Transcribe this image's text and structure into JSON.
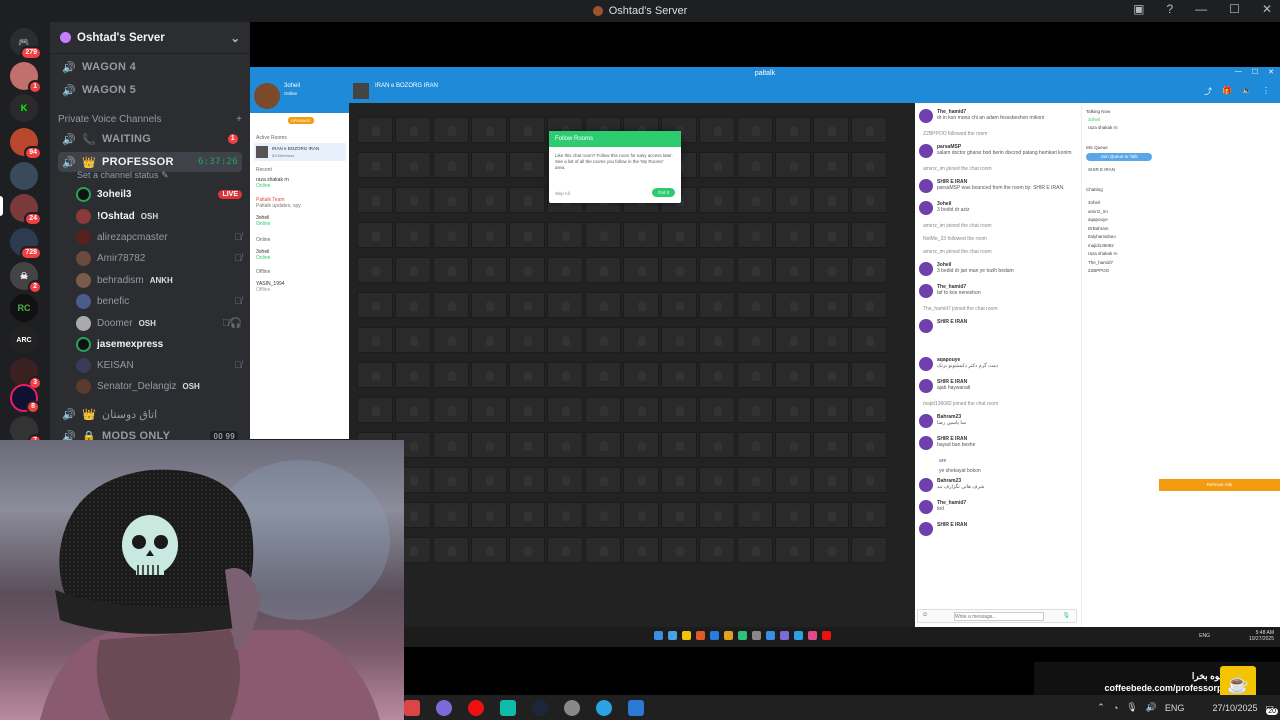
{
  "window": {
    "title": "Oshtad's Server"
  },
  "servers": {
    "badges": [
      "279",
      "1",
      "94",
      "24",
      "728",
      "2",
      "3",
      "8",
      "7"
    ]
  },
  "sidebar": {
    "server_name": "Oshtad's Server",
    "channels": [
      {
        "name": "WAGON 4"
      },
      {
        "name": "WAGON 5"
      }
    ],
    "category": "Private Voice Channels",
    "waiting": {
      "name": "WAITING",
      "count": "1"
    },
    "professor": {
      "name": "PROFESSOR",
      "timer": "6:37:26",
      "status": "Set a channel status"
    },
    "members": [
      {
        "name": "3oheil3",
        "live": "LIVE",
        "tag": ""
      },
      {
        "name": "!Oshtad",
        "tag": "OSH"
      },
      {
        "name": "alirezapcmaster",
        "tag": ""
      },
      {
        "name": "Amir78782",
        "tag": ""
      },
      {
        "name": "behradism",
        "tag": "ANKH"
      },
      {
        "name": "benefic",
        "tag": ""
      },
      {
        "name": "Doomer",
        "tag": "OSH"
      },
      {
        "name": "jasemexpress",
        "tag": ""
      },
      {
        "name": "KEISAN",
        "tag": ""
      },
      {
        "name": "Senator_Delangiz",
        "tag": "OSH"
      }
    ],
    "arabic_channel": "اتاق دوستان",
    "mods": {
      "name": "MODS ONLY",
      "a": "00",
      "b": "99"
    }
  },
  "paltalk": {
    "title": "paltalk",
    "user": {
      "name": "3oheil",
      "status": "Online",
      "upgrade": "UPGRADE"
    },
    "room": {
      "name": "IRAN e BOZORG IRAN",
      "members": "53 Members",
      "section_active": "Active Rooms",
      "section_recent": "Recent",
      "section_online": "Online",
      "section_offline": "Offline"
    },
    "recent": [
      {
        "name": "raza shakak rn",
        "status": "Online"
      },
      {
        "name": "Paltalk Team",
        "status": "Paltalk updates, spy"
      },
      {
        "name": "3oheil",
        "status": "Online"
      }
    ],
    "online": [
      {
        "name": "3oheil",
        "status": "Online"
      }
    ],
    "offline": [
      {
        "name": "YASIN_1994",
        "status": "Offline"
      }
    ],
    "popup": {
      "title": "Follow Rooms",
      "body": "Like this chat room? Follow this room for easy access later. See a list of all the rooms you follow in the 'My Rooms' area.",
      "skip": "Skip All",
      "go": "Got It"
    },
    "chat": [
      {
        "user": "The_hamid7",
        "text": "dr in kon mona chi an adam fesssbeshon mikoni"
      },
      {
        "sys": "Z2BPPOO followed the room"
      },
      {
        "user": "parsaMSP",
        "text": "salam doctor gharar bod berin discrod palang hamkari konim"
      },
      {
        "sys": "amirrz_im joined the chat room"
      },
      {
        "user": "SHIR E IRAN",
        "text": "parsaMSP was bounced from the room by: SHIR E IRAN."
      },
      {
        "user": "3oheil",
        "text": "3 bedid dr aziz"
      },
      {
        "sys": "amirrz_im joined the chat room"
      },
      {
        "sys": "NotMe_33 followed the room"
      },
      {
        "sys": "amirrz_im joined the chat room"
      },
      {
        "user": "3oheil",
        "text": "3 bedid dr jan man ye tozih bedam"
      },
      {
        "user": "The_hamid7",
        "text": "taf to kos neneshon"
      },
      {
        "sys": "The_hamid7 joined the chat room"
      },
      {
        "user": "SHIR E IRAN",
        "text": ""
      },
      {
        "user": "aqapouye",
        "text": "دمت گرم دکتر دکمشونو بزنک"
      },
      {
        "user": "SHIR E IRAN",
        "text": "ajab haywanati"
      },
      {
        "sys": "majid136082 joined the chat room"
      },
      {
        "user": "Bahram23",
        "text": "سا یاسین رضا"
      },
      {
        "user": "SHIR E IRAN",
        "text": "bayad ban beshe"
      },
      {
        "text2": "are"
      },
      {
        "text2": "ye shekayat bokon"
      },
      {
        "user": "Bahram23",
        "text": "شرف هاتی تگزارف نبد"
      },
      {
        "user": "The_hamid7",
        "text": "tod"
      },
      {
        "user": "SHIR E IRAN",
        "text": ""
      }
    ],
    "input_placeholder": "Write a message...",
    "talking_now": "Talking Now",
    "talkers": [
      "3oheil",
      "raza shakak rn"
    ],
    "mic_queue": "Mic Queue",
    "join_queue": "Join Queue to Talk",
    "queue_user": "SHIR E IRAN",
    "chatting": "Chatting",
    "chatters": [
      "3oheil",
      "amirrz_im",
      "aqapouye",
      "DrBahram",
      "Italyhamidseo",
      "majid136082",
      "raza shakak rn",
      "The_hamid7",
      "Z2BPPOO"
    ],
    "remove_ads": "Remove Ads"
  },
  "inner_taskbar": {
    "lang": "ENG",
    "time": "5:48 AM",
    "date": "10/27/2025"
  },
  "coffee": {
    "line1": "برام قهوه بخرا",
    "line2": "coffeebede.com/professorpalang"
  },
  "host_taskbar": {
    "lang": "ENG",
    "date": "27/10/2025",
    "notif": "20"
  }
}
